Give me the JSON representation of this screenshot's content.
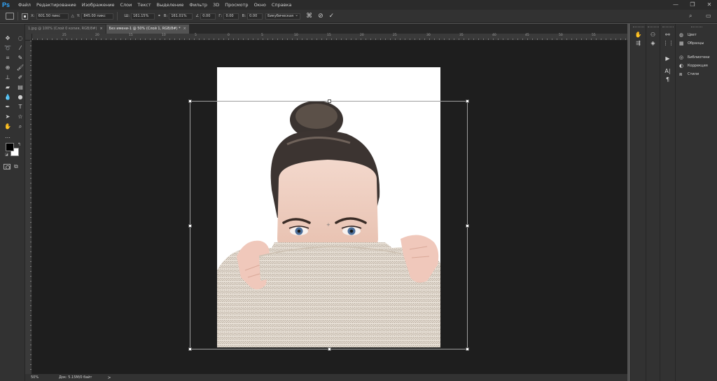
{
  "app": {
    "logo": "Ps"
  },
  "menu": [
    "Файл",
    "Редактирование",
    "Изображение",
    "Слои",
    "Текст",
    "Выделение",
    "Фильтр",
    "3D",
    "Просмотр",
    "Окно",
    "Справка"
  ],
  "window_controls": {
    "minimize": "—",
    "restore": "❐",
    "close": "✕"
  },
  "options": {
    "x_label": "X:",
    "x_value": "601.50 пикс",
    "y_label": "Y:",
    "y_value": "845.00 пикс",
    "w_label": "Ш:",
    "w_value": "161.15%",
    "h_label": "В:",
    "h_value": "161.01%",
    "angle_label": "∠",
    "angle_value": "0.00",
    "hskew_label": "Г:",
    "hskew_value": "0.00",
    "vskew_label": "В:",
    "vskew_value": "0.00",
    "interpolation": "Бикубическая",
    "cancel_icon": "⊘",
    "commit_icon": "✓"
  },
  "tabs": [
    {
      "label": "1.jpg @ 100% (Слой 0 копия, RGB/8#)",
      "close": "×",
      "active": false
    },
    {
      "label": "Без имени-1 @ 50% (Слой 1, RGB/8#) *",
      "close": "×",
      "active": true
    }
  ],
  "ruler_top_labels": [
    "25",
    "20",
    "15",
    "10",
    "5",
    "0",
    "5",
    "10",
    "15",
    "20",
    "25",
    "30",
    "35",
    "40",
    "45",
    "50",
    "55"
  ],
  "status": {
    "zoom": "50%",
    "doc": "Док: 5.15М/0 байт",
    "arrow": ">"
  },
  "panels": {
    "group1": [
      {
        "label": "Цвет",
        "icon": "color-wheel-icon"
      },
      {
        "label": "Образцы",
        "icon": "swatches-grid-icon"
      }
    ],
    "group2": [
      {
        "label": "Библиотеки",
        "icon": "libraries-icon"
      },
      {
        "label": "Коррекция",
        "icon": "adjustments-icon"
      },
      {
        "label": "Стили",
        "icon": "styles-icon"
      }
    ]
  }
}
